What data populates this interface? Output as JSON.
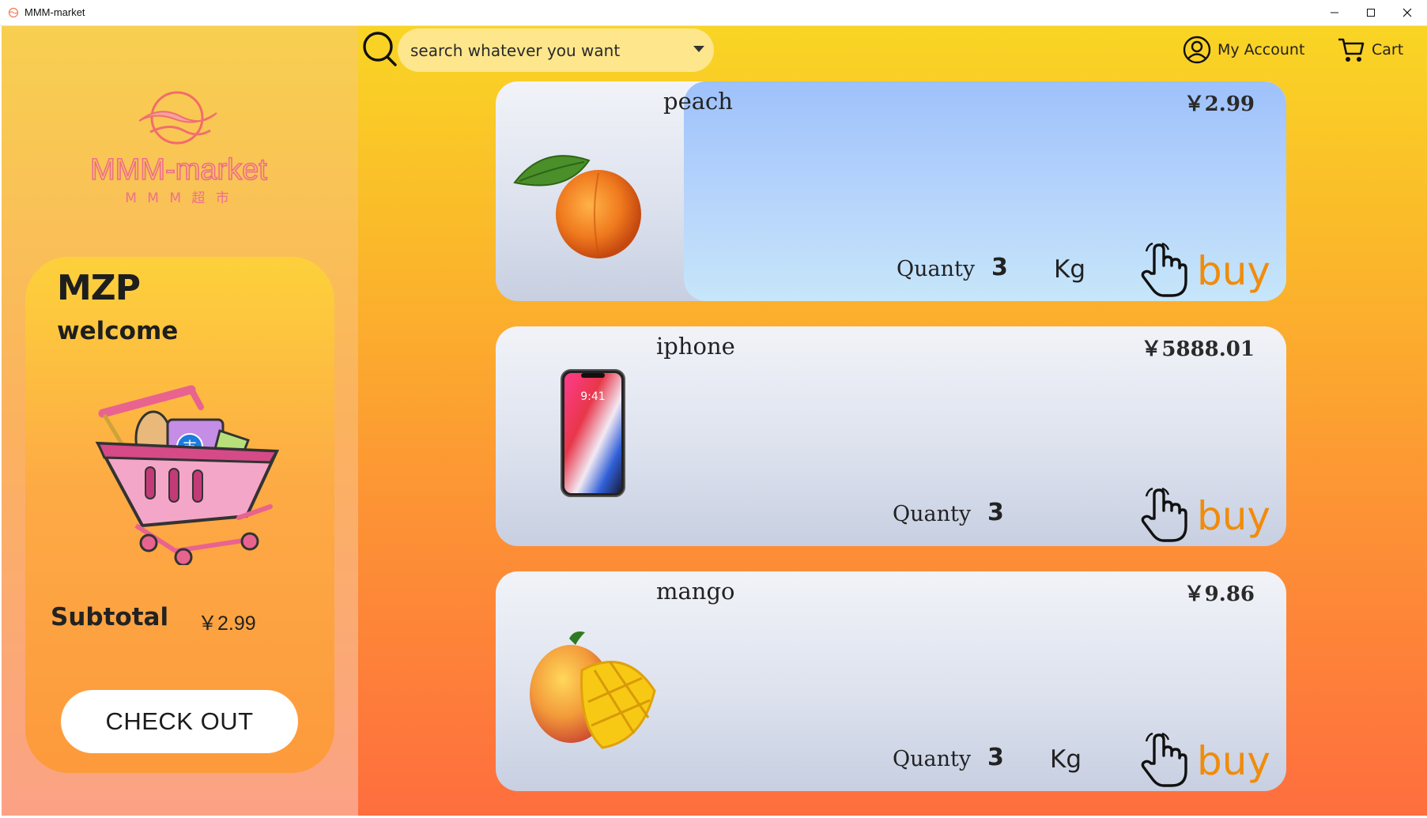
{
  "window": {
    "title": "MMM-market"
  },
  "sidebar": {
    "logo": {
      "name": "MMM-market",
      "subtitle": "M M M 超 市"
    },
    "user": {
      "name": "MZP",
      "greeting": "welcome"
    },
    "subtotal": {
      "label": "Subtotal",
      "value": "￥2.99"
    },
    "checkout_label": "CHECK OUT"
  },
  "header": {
    "search": {
      "placeholder": "search whatever you want"
    },
    "account_label": "My Account",
    "cart_label": "Cart"
  },
  "products": [
    {
      "name": "peach",
      "price": "￥2.99",
      "quantity_label": "Quanty",
      "quantity": "3",
      "unit": "Kg",
      "buy_label": "buy",
      "image_icon": "peach-image",
      "highlighted": true
    },
    {
      "name": "iphone",
      "price": "￥5888.01",
      "quantity_label": "Quanty",
      "quantity": "3",
      "unit": "",
      "buy_label": "buy",
      "image_icon": "iphone-image",
      "highlighted": false
    },
    {
      "name": "mango",
      "price": "￥9.86",
      "quantity_label": "Quanty",
      "quantity": "3",
      "unit": "Kg",
      "buy_label": "buy",
      "image_icon": "mango-image",
      "highlighted": false
    }
  ],
  "colors": {
    "accent_buy": "#f08c0c",
    "highlight_card": "#b7d5fb",
    "search_fill": "#fde68c",
    "logo_pink": "#f06a8a"
  }
}
